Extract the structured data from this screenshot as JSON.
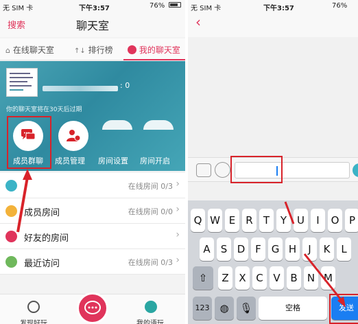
{
  "left": {
    "status": {
      "carrier": "无 SIM 卡",
      "time": "下午3:57",
      "battery": "76%"
    },
    "nav": {
      "left_button": "搜索",
      "title": "聊天室"
    },
    "tabs": [
      {
        "label": "在线聊天室",
        "icon": "home-icon"
      },
      {
        "label": "排行榜",
        "icon": "ranking-icon"
      },
      {
        "label": "我的聊天室",
        "icon": "user-circle-icon",
        "active": true
      }
    ],
    "banner": {
      "value_suffix": ": 0",
      "expire_text": "你的聊天室将在30天后过期",
      "functions": [
        {
          "label": "成员群聊",
          "icon": "group-chat-icon"
        },
        {
          "label": "成员管理",
          "icon": "member-manage-icon"
        },
        {
          "label": "房间设置",
          "icon": "settings-icon"
        },
        {
          "label": "房间开启",
          "icon": "power-icon"
        }
      ]
    },
    "rows": [
      {
        "label": "",
        "right": "在线房间 0/3",
        "icon": "heart-icon",
        "color": "#3bb3c6"
      },
      {
        "label": "成员房间",
        "right": "在线房间 0/0",
        "icon": "chat-bubble-icon",
        "color": "#f3b23a"
      },
      {
        "label": "好友的房间",
        "right": "",
        "icon": "house-icon",
        "color": "#e0345b"
      },
      {
        "label": "最近访问",
        "right": "在线房间 0/3",
        "icon": "glasses-icon",
        "color": "#6fb85c"
      }
    ],
    "bottom": {
      "discover": "发现好玩",
      "mine": "我的语玩"
    }
  },
  "right": {
    "status": {
      "carrier": "无 SIM 卡",
      "time": "下午3:57",
      "battery": "76%"
    },
    "keyboard": {
      "row1": [
        "Q",
        "W",
        "E",
        "R",
        "T",
        "Y",
        "U",
        "I",
        "O",
        "P"
      ],
      "row2": [
        "A",
        "S",
        "D",
        "F",
        "G",
        "H",
        "J",
        "K",
        "L"
      ],
      "row3": [
        "Z",
        "X",
        "C",
        "V",
        "B",
        "N",
        "M"
      ],
      "mode_key": "123",
      "space_key": "空格",
      "send_key": "发送"
    }
  },
  "colors": {
    "accent": "#e0345b",
    "highlight_box": "#d8232a",
    "teal": "#3bb3c6",
    "key_blue": "#1a7ef2"
  }
}
